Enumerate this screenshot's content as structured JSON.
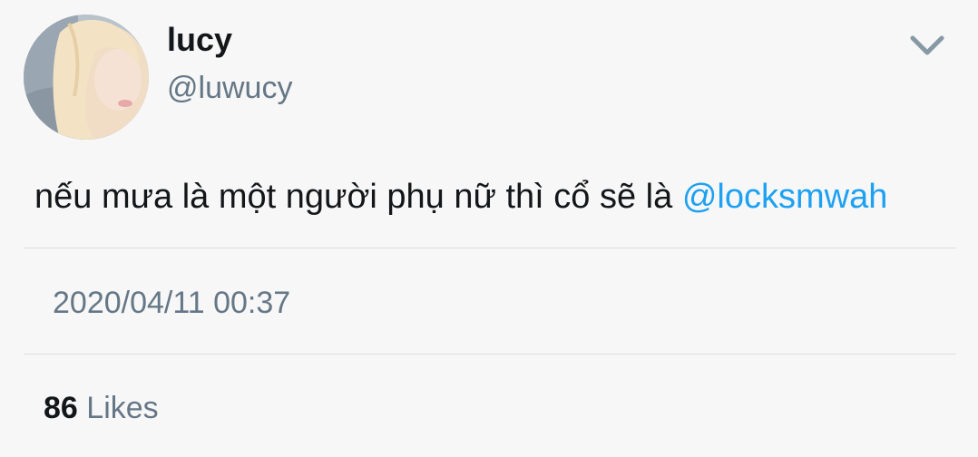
{
  "user": {
    "display_name": "lucy",
    "handle": "@luwucy"
  },
  "tweet": {
    "text": "nếu mưa là một người phụ nữ thì cổ sẽ là ",
    "mention": "@locksmwah",
    "timestamp": "2020/04/11 00:37"
  },
  "stats": {
    "likes_count": "86",
    "likes_label": "Likes"
  },
  "icons": {
    "caret": "chevron-down-icon",
    "avatar": "user-avatar"
  },
  "colors": {
    "mention": "#1da1f2",
    "secondary_text": "#657786",
    "background": "#f7f7f7"
  }
}
